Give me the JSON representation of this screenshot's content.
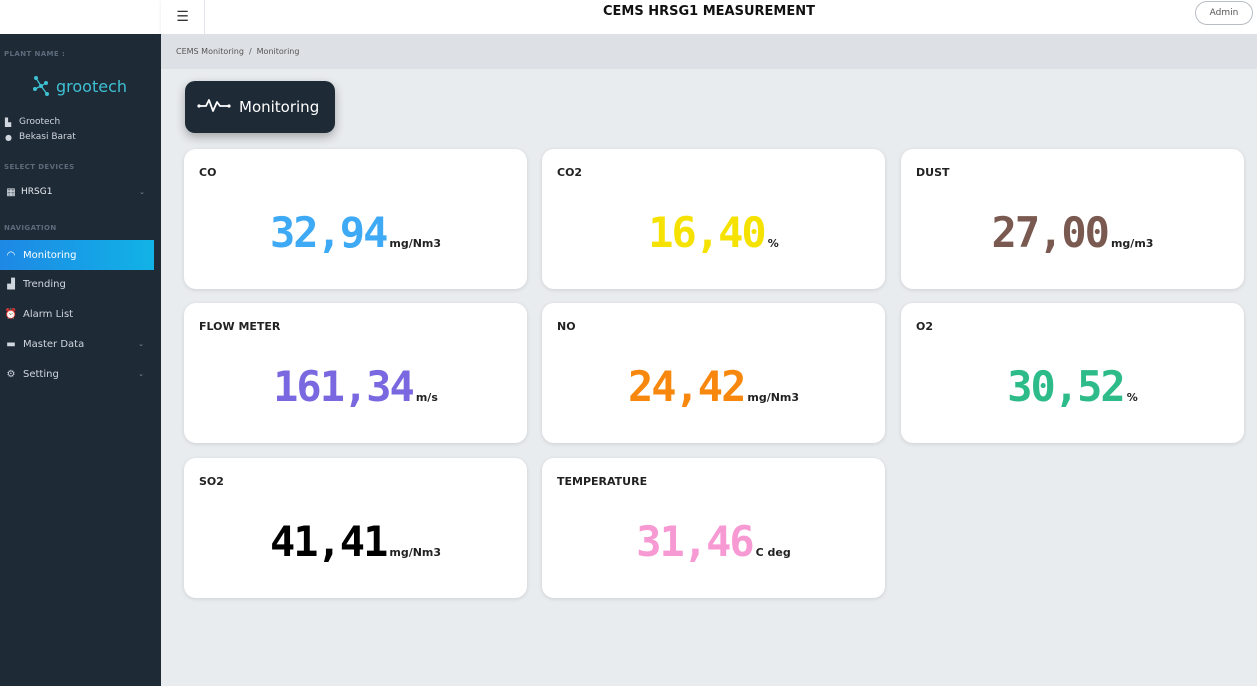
{
  "sidebar": {
    "plant_label": "PLANT NAME :",
    "brand": "grootech",
    "plant_name": "Grootech",
    "plant_location": "Bekasi Barat",
    "select_devices_label": "SELECT DEVICES",
    "device": "HRSG1",
    "navigation_label": "NAVIGATION",
    "items": [
      {
        "label": "Monitoring"
      },
      {
        "label": "Trending"
      },
      {
        "label": "Alarm List"
      },
      {
        "label": "Master Data"
      },
      {
        "label": "Setting"
      }
    ]
  },
  "topbar": {
    "title": "CEMS HRSG1 MEASUREMENT",
    "admin_label": "Admin"
  },
  "breadcrumb": {
    "root": "CEMS Monitoring",
    "separator": "/",
    "current": "Monitoring"
  },
  "section": {
    "title": "Monitoring"
  },
  "cards": [
    {
      "title": "CO",
      "value": "32,94",
      "unit": "mg/Nm3",
      "color": "#3ea9f5"
    },
    {
      "title": "CO2",
      "value": "16,40",
      "unit": "%",
      "color": "#f5e200"
    },
    {
      "title": "DUST",
      "value": "27,00",
      "unit": "mg/m3",
      "color": "#7a5a50"
    },
    {
      "title": "FLOW METER",
      "value": "161,34",
      "unit": "m/s",
      "color": "#7a68e0"
    },
    {
      "title": "NO",
      "value": "24,42",
      "unit": "mg/Nm3",
      "color": "#f7880d"
    },
    {
      "title": "O2",
      "value": "30,52",
      "unit": "%",
      "color": "#2dbb8a"
    },
    {
      "title": "SO2",
      "value": "41,41",
      "unit": "mg/Nm3",
      "color": "#000000"
    },
    {
      "title": "TEMPERATURE",
      "value": "31,46",
      "unit": "C deg",
      "color": "#f79ad4"
    }
  ]
}
